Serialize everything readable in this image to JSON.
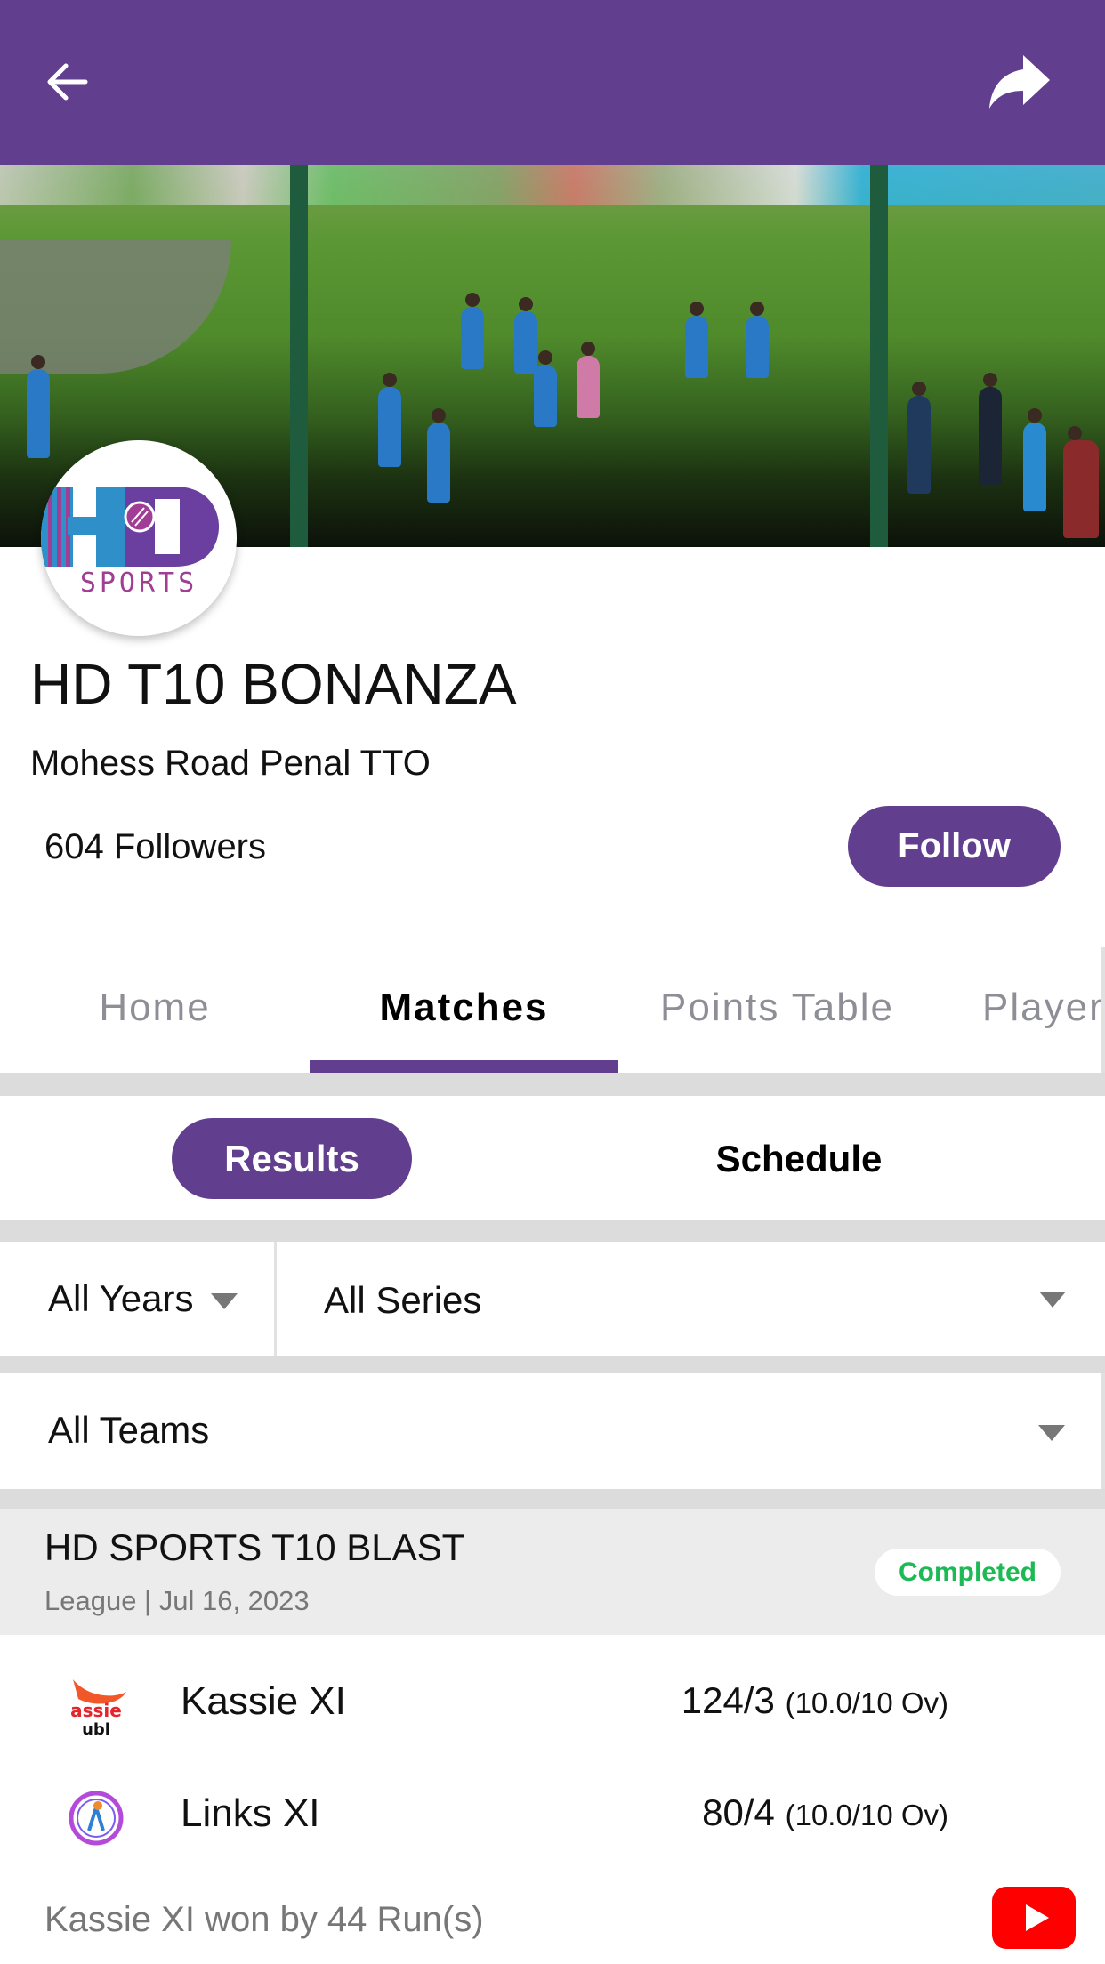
{
  "colors": {
    "brand": "#623e8f",
    "status_completed": "#1db954",
    "youtube": "#ff0000",
    "muted_text": "#777777",
    "inactive_tab": "#8e8e96"
  },
  "topbar": {
    "back_icon": "arrow-left-icon",
    "share_icon": "share-icon"
  },
  "profile": {
    "logo_text_main": "HD",
    "logo_text_sub": "SPORTS",
    "title": "HD T10 BONANZA",
    "location": "Mohess Road Penal TTO",
    "followers": "604 Followers",
    "follow_label": "Follow"
  },
  "tabs": [
    {
      "label": "Home",
      "active": false
    },
    {
      "label": "Matches",
      "active": true
    },
    {
      "label": "Points Table",
      "active": false
    },
    {
      "label": "Player",
      "active": false
    }
  ],
  "segment": {
    "results_label": "Results",
    "schedule_label": "Schedule",
    "selected": "Results"
  },
  "filters": {
    "years": "All Years",
    "series": "All Series",
    "teams": "All Teams"
  },
  "matches": [
    {
      "series_name": "HD SPORTS T10 BLAST",
      "meta": "League | Jul 16, 2023",
      "status": "Completed",
      "teams": [
        {
          "name": "Kassie XI",
          "score": "124/3",
          "overs": "(10.0/10 Ov)"
        },
        {
          "name": "Links XI",
          "score": "80/4",
          "overs": "(10.0/10 Ov)"
        }
      ],
      "result": "Kassie XI won by 44 Run(s)",
      "video_icon": "youtube-icon"
    }
  ]
}
